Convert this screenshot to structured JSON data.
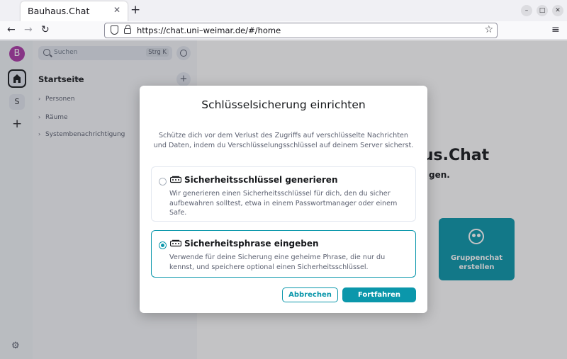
{
  "browser": {
    "tab_title": "Bauhaus.Chat",
    "url": "https://chat.uni–weimar.de/#/home"
  },
  "spaces": {
    "avatar_letter": "B",
    "space_letter": "S"
  },
  "roomlist": {
    "search_placeholder": "Suchen",
    "search_shortcut": "Strg K",
    "home_title": "Startseite",
    "sections": [
      "Personen",
      "Räume",
      "Systembenachrichtigung"
    ]
  },
  "main": {
    "welcome_partial": "aus.Chat",
    "welcome_sub_partial": "gen.",
    "group_chat_line1": "Gruppenchat",
    "group_chat_line2": "erstellen"
  },
  "dialog": {
    "title": "Schlüsselsicherung einrichten",
    "description": "Schütze dich vor dem Verlust des Zugriffs auf verschlüsselte Nachrichten und Daten, indem du Verschlüsselungsschlüssel auf deinem Server sicherst.",
    "options": [
      {
        "title": "Sicherheitsschlüssel generieren",
        "description": "Wir generieren einen Sicherheitsschlüssel für dich, den du sicher aufbewahren solltest, etwa in einem Passwortmanager oder einem Safe.",
        "selected": false
      },
      {
        "title": "Sicherheitsphrase eingeben",
        "description": "Verwende für deine Sicherung eine geheime Phrase, die nur du kennst, und speichere optional einen Sicherheitsschlüssel.",
        "selected": true
      }
    ],
    "cancel_label": "Abbrechen",
    "continue_label": "Fortfahren"
  },
  "colors": {
    "accent": "#0b97ab",
    "avatar": "#ac3ba8"
  }
}
